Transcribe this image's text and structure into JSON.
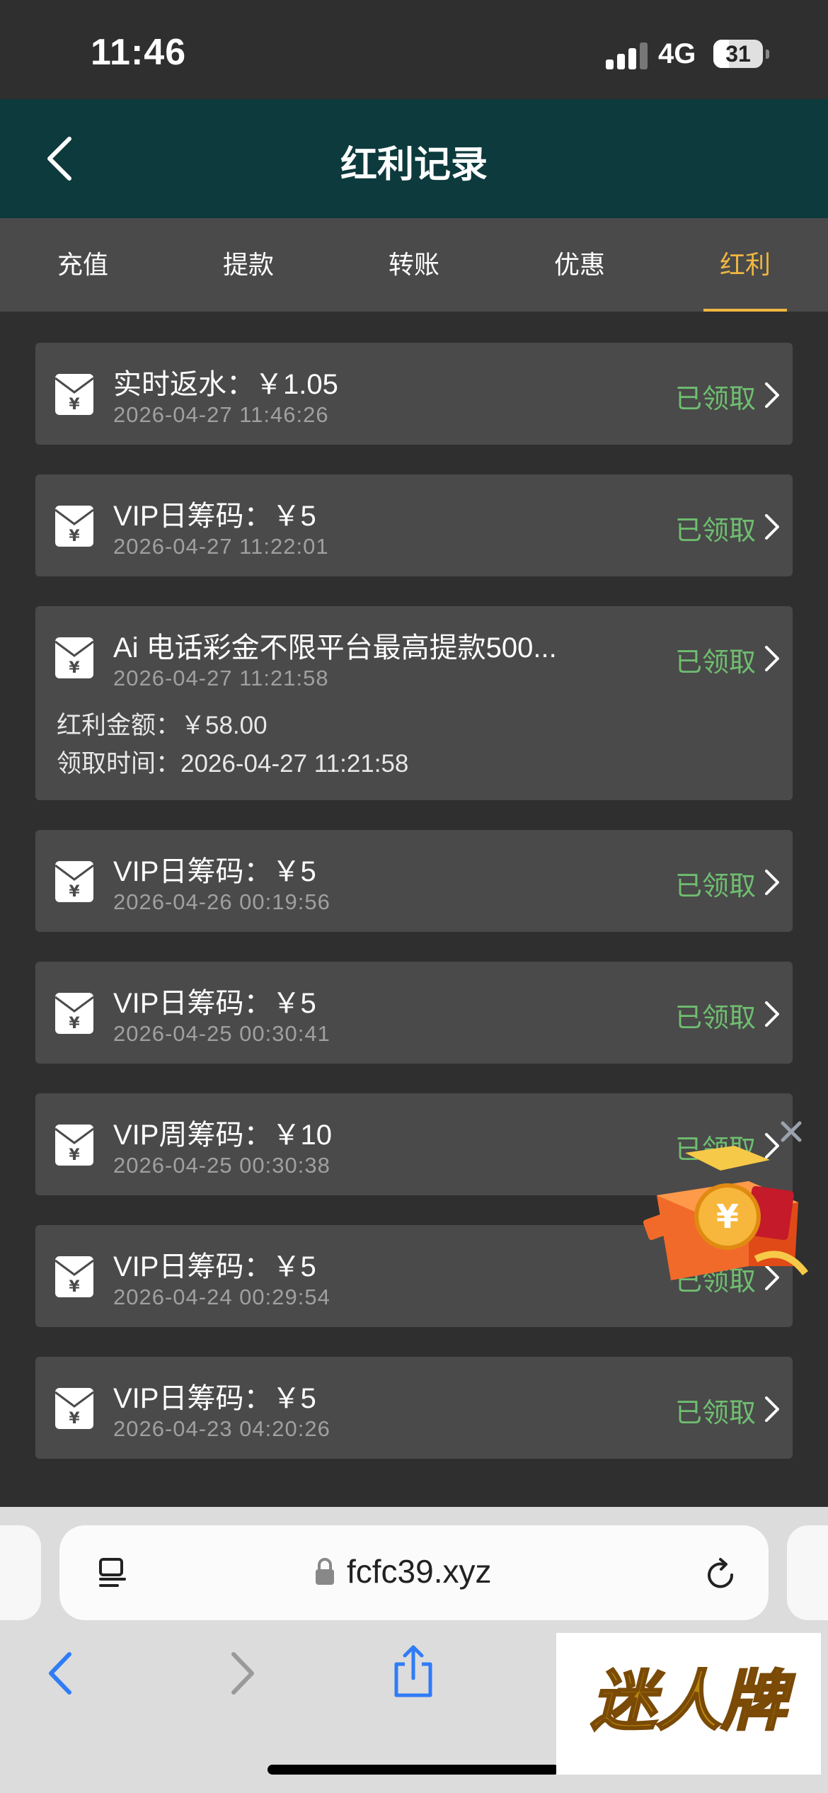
{
  "status_bar": {
    "time": "11:46",
    "network": "4G",
    "battery": "31"
  },
  "header": {
    "title": "红利记录"
  },
  "tabs": [
    {
      "label": "充值"
    },
    {
      "label": "提款"
    },
    {
      "label": "转账"
    },
    {
      "label": "优惠"
    },
    {
      "label": "红利",
      "active": true
    }
  ],
  "records": [
    {
      "title": "实时返水：￥1.05",
      "time": "2026-04-27 11:46:26",
      "status": "已领取"
    },
    {
      "title": "VIP日筹码：￥5",
      "time": "2026-04-27 11:22:01",
      "status": "已领取"
    },
    {
      "title": "Ai 电话彩金不限平台最高提款500...",
      "time": "2026-04-27 11:21:58",
      "status": "已领取",
      "amount_line": "红利金额：￥58.00",
      "claim_line": "领取时间：2026-04-27 11:21:58"
    },
    {
      "title": "VIP日筹码：￥5",
      "time": "2026-04-26 00:19:56",
      "status": "已领取"
    },
    {
      "title": "VIP日筹码：￥5",
      "time": "2026-04-25 00:30:41",
      "status": "已领取"
    },
    {
      "title": "VIP周筹码：￥10",
      "time": "2026-04-25 00:30:38",
      "status": "已领取"
    },
    {
      "title": "VIP日筹码：￥5",
      "time": "2026-04-24 00:29:54",
      "status": "已领取"
    },
    {
      "title": "VIP日筹码：￥5",
      "time": "2026-04-23 04:20:26",
      "status": "已领取"
    }
  ],
  "browser": {
    "url": "fcfc39.xyz"
  },
  "watermark": {
    "text": "迷人牌"
  },
  "colors": {
    "header_bg": "#0d3a3c",
    "active_tab": "#f0b641",
    "claimed": "#6fbe70",
    "card_bg": "#4a4a4a",
    "page_bg": "#2f2f2f",
    "link_blue": "#2f7cf6"
  }
}
